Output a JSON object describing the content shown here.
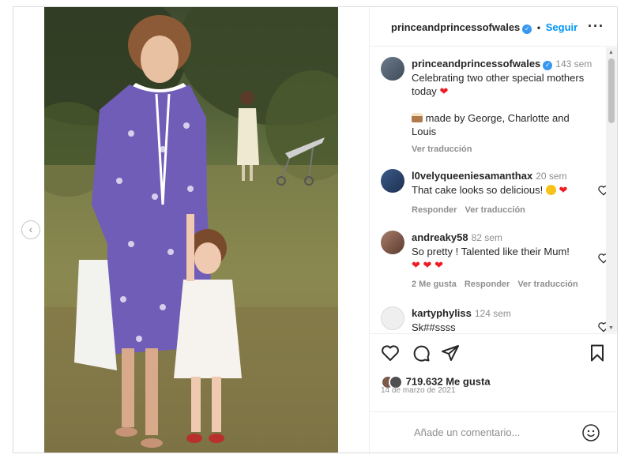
{
  "header": {
    "username": "princeandprincessofwales",
    "separator": "•",
    "follow_label": "Seguir",
    "more_icon": "more-horizontal-icon"
  },
  "caption": {
    "username": "princeandprincessofwales",
    "time": "143 sem",
    "text_line1": "Celebrating two other special mothers",
    "text_line2": "today",
    "text_line3": "made by George, Charlotte and",
    "text_line4": "Louis",
    "translate_label": "Ver traducción"
  },
  "comments": [
    {
      "username": "l0velyqueeniesamanthax",
      "time": "20 sem",
      "text": "That cake looks so delicious!",
      "reply_label": "Responder",
      "translate_label": "Ver traducción"
    },
    {
      "username": "andreaky58",
      "time": "82 sem",
      "text": "So pretty ! Talented like their Mum!",
      "likes_label": "2 Me gusta",
      "reply_label": "Responder",
      "translate_label": "Ver traducción"
    },
    {
      "username": "kartyphyliss",
      "time": "124 sem",
      "text": "Sk##ssss"
    }
  ],
  "actions": {
    "likes": "719.632 Me gusta",
    "date": "14 de marzo de 2021"
  },
  "add_comment": {
    "placeholder": "Añade un comentario..."
  },
  "colors": {
    "accent": "#0095f6",
    "verified": "#3897f0",
    "heart": "#ed1c24",
    "muted": "#8e8e8e"
  }
}
